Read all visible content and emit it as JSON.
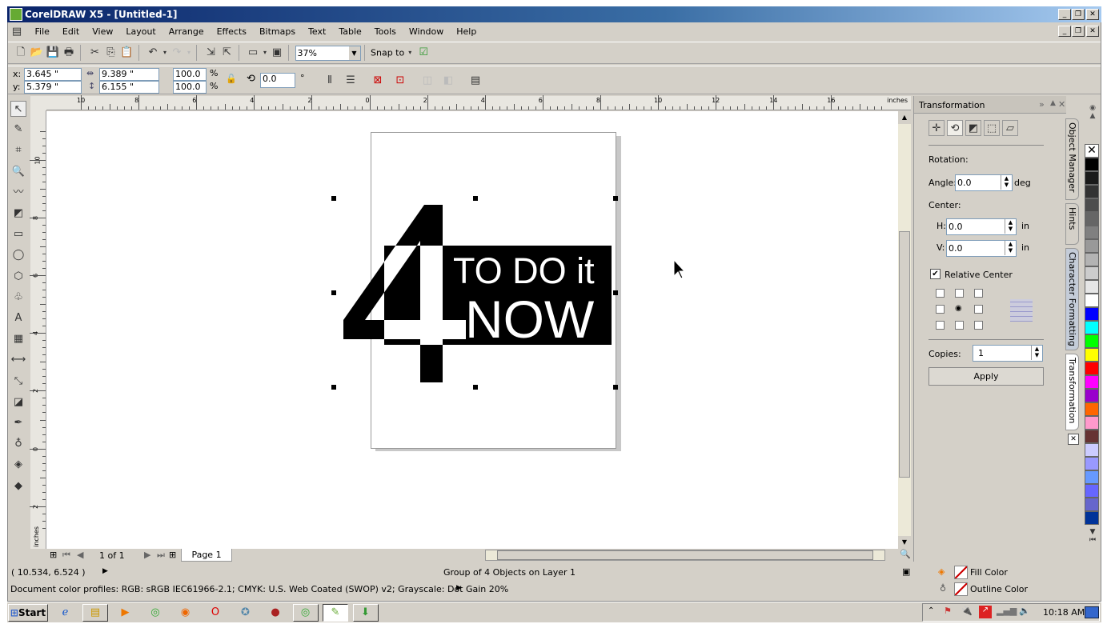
{
  "window": {
    "title": "CorelDRAW X5 - [Untitled-1]"
  },
  "menu": [
    "File",
    "Edit",
    "View",
    "Layout",
    "Arrange",
    "Effects",
    "Bitmaps",
    "Text",
    "Table",
    "Tools",
    "Window",
    "Help"
  ],
  "toolbar": {
    "zoom": "37%",
    "snap_to": "Snap to"
  },
  "property_bar": {
    "x_label": "x:",
    "x": "3.645 \"",
    "y_label": "y:",
    "y": "5.379 \"",
    "width": "9.389 \"",
    "height": "6.155 \"",
    "scale_x": "100.0",
    "scale_y": "100.0",
    "pct": "%",
    "rotation": "0.0",
    "deg_symbol": "°"
  },
  "ruler": {
    "unit": "inches",
    "h_ticks": [
      "10",
      "8",
      "6",
      "4",
      "2",
      "0",
      "2",
      "4",
      "6",
      "8",
      "10",
      "12",
      "14",
      "16"
    ],
    "v_ticks": [
      "10",
      "8",
      "6",
      "4",
      "2",
      "0",
      "2"
    ]
  },
  "artwork": {
    "line1": "TO DO it",
    "line2": "NOW",
    "glyph": "4"
  },
  "page_nav": {
    "count": "1 of 1",
    "tab": "Page 1"
  },
  "docker": {
    "title": "Transformation",
    "rotation_label": "Rotation:",
    "angle_label": "Angle:",
    "angle": "0.0",
    "angle_unit": "deg",
    "center_label": "Center:",
    "h_label": "H:",
    "h": "0.0",
    "v_label": "V:",
    "v": "0.0",
    "unit": "in",
    "relative_center": "Relative Center",
    "relative_center_checked": true,
    "copies_label": "Copies:",
    "copies": "1",
    "apply": "Apply"
  },
  "docker_tabs": [
    "Object Manager",
    "Hints",
    "Character Formatting",
    "Transformation"
  ],
  "palette": [
    "#000000",
    "#1a1a1a",
    "#333333",
    "#4d4d4d",
    "#666666",
    "#808080",
    "#999999",
    "#b3b3b3",
    "#cccccc",
    "#e6e6e6",
    "#ffffff",
    "#0000ff",
    "#00ffff",
    "#00ff00",
    "#ffff00",
    "#ff0000",
    "#ff00ff",
    "#9900cc",
    "#ff6600",
    "#ff99cc",
    "#663333",
    "#ccccff",
    "#9999ff",
    "#6699ff",
    "#6666ff",
    "#6666cc",
    "#003399"
  ],
  "status": {
    "coords": "( 10.534, 6.524 )",
    "selection": "Group of 4 Objects on Layer 1",
    "profiles": "Document color profiles: RGB: sRGB IEC61966-2.1; CMYK: U.S. Web Coated (SWOP) v2; Grayscale: Dot Gain 20%",
    "fill": "Fill Color",
    "outline": "Outline Color"
  },
  "taskbar": {
    "start": "Start",
    "clock": "10:18 AM"
  }
}
